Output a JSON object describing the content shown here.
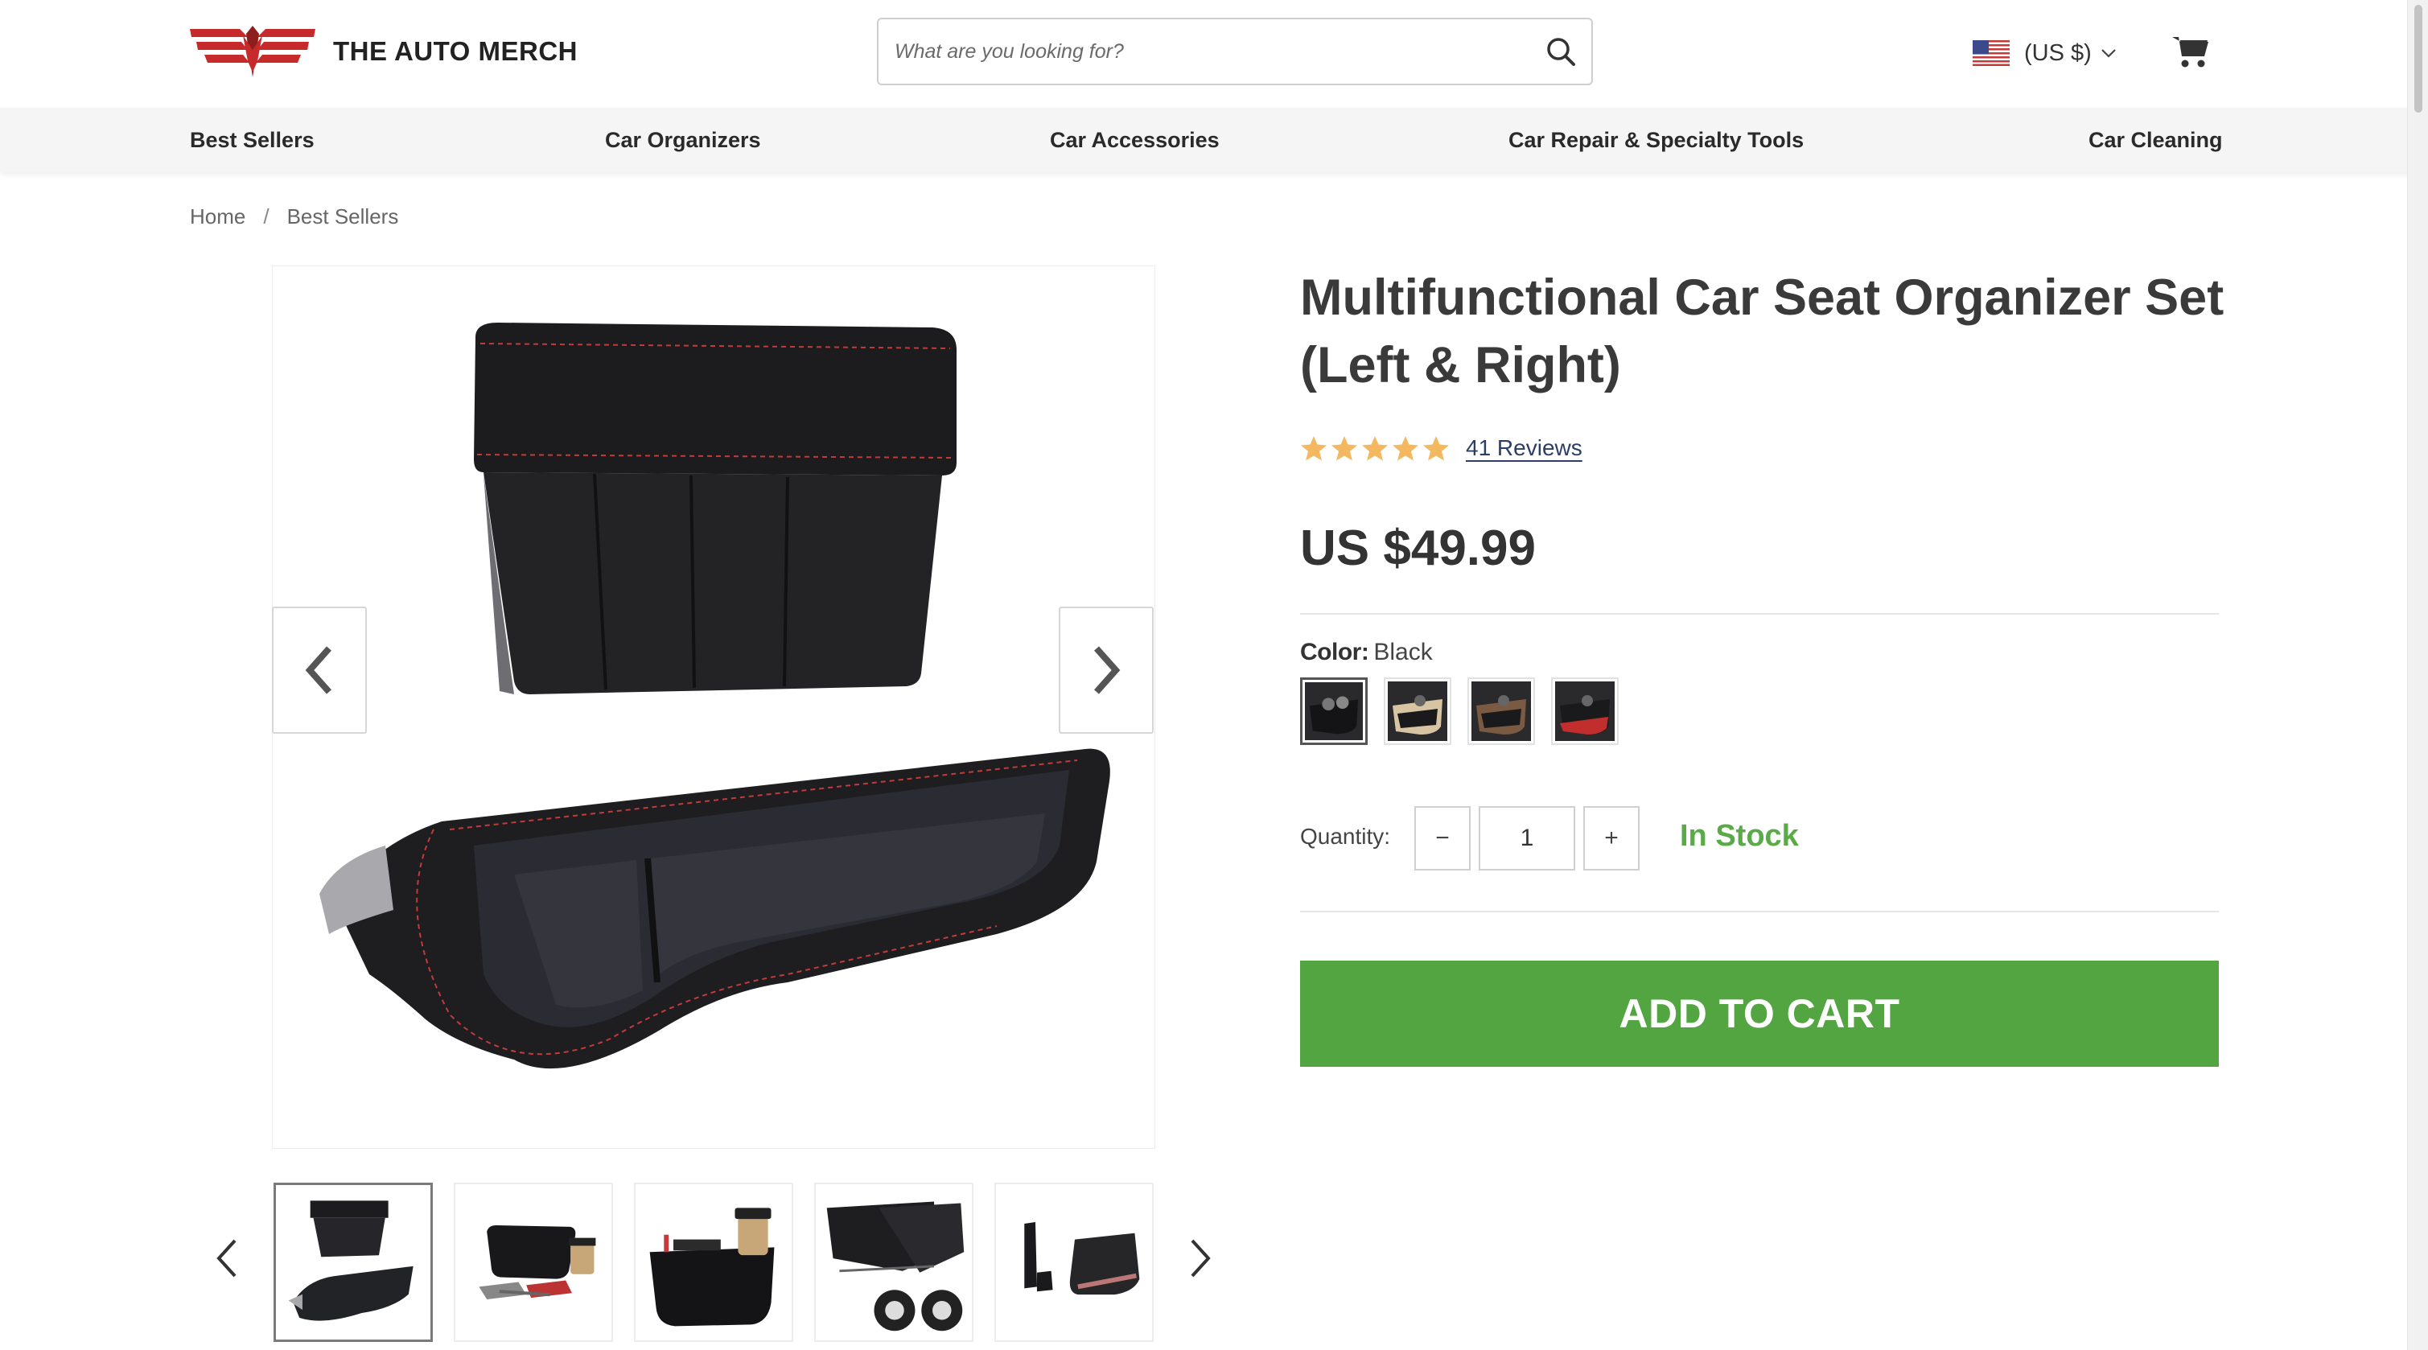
{
  "header": {
    "brand": "THE AUTO MERCH",
    "search_placeholder": "What are you looking for?",
    "currency": "(US $)",
    "icons": {
      "search": "search-icon",
      "cart": "cart-icon",
      "flag": "us-flag-icon",
      "chevron": "chevron-down-icon"
    }
  },
  "nav": {
    "items": [
      {
        "label": "Best Sellers"
      },
      {
        "label": "Car Organizers"
      },
      {
        "label": "Car Accessories"
      },
      {
        "label": "Car Repair & Specialty Tools"
      },
      {
        "label": "Car Cleaning"
      }
    ]
  },
  "breadcrumb": {
    "home": "Home",
    "separator": "/",
    "current": "Best Sellers"
  },
  "product": {
    "title": "Multifunctional Car Seat Organizer Set (Left & Right)",
    "rating": 5,
    "reviews_label": "41 Reviews",
    "price": "US $49.99",
    "color_label": "Color:",
    "color_value": "Black",
    "swatch_count": 4,
    "quantity_label": "Quantity:",
    "quantity": "1",
    "minus": "−",
    "plus": "+",
    "stock": "In Stock",
    "add_to_cart": "ADD TO CART"
  },
  "gallery": {
    "thumbnail_count": 5,
    "active_thumbnail": 1
  },
  "colors": {
    "brand_red": "#c62a2a",
    "accent_green": "#52a540",
    "stock_green": "#5aaa48",
    "star_gold": "#f4b860",
    "link_blue": "#2c3e66"
  }
}
